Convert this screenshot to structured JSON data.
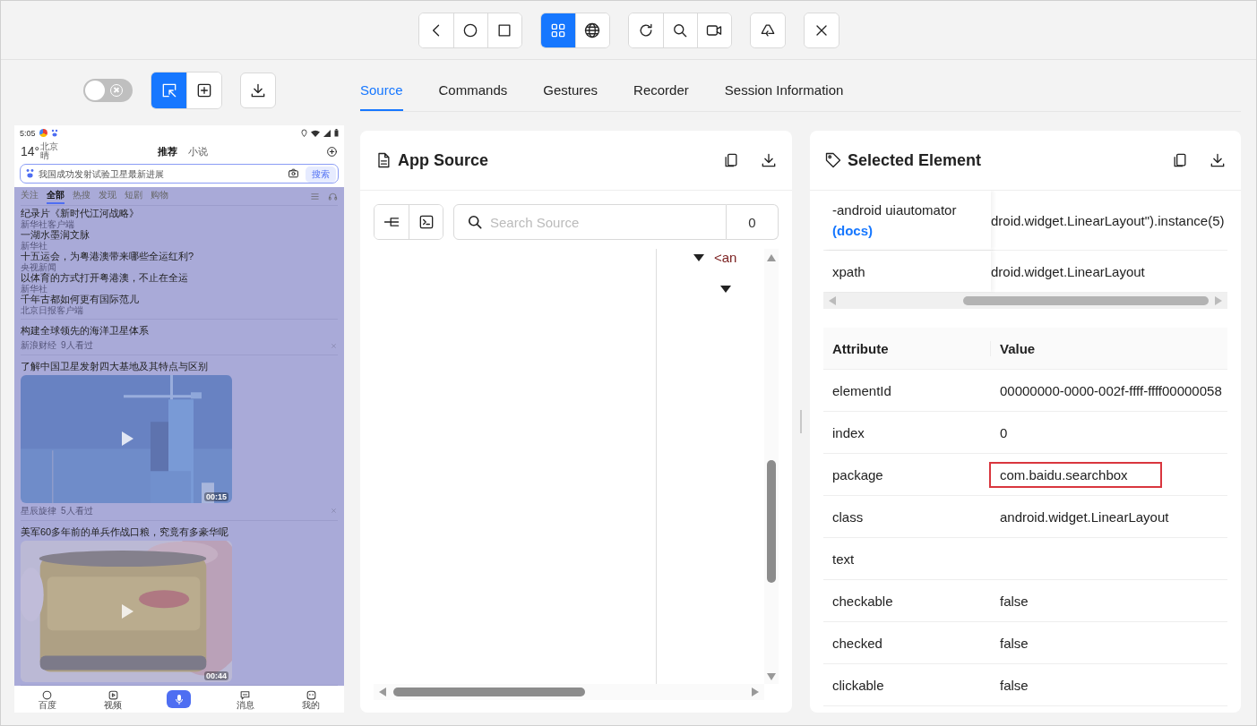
{
  "toolbar": {
    "groups": [
      {
        "buttons": [
          {
            "kind": "back"
          },
          {
            "kind": "home"
          },
          {
            "kind": "recent"
          }
        ]
      },
      {
        "buttons": [
          {
            "kind": "native",
            "selected": true
          },
          {
            "kind": "web",
            "selected": false
          }
        ]
      },
      {
        "buttons": [
          {
            "kind": "refresh"
          },
          {
            "kind": "search"
          },
          {
            "kind": "record"
          }
        ]
      },
      {
        "buttons": [
          {
            "kind": "recycle"
          }
        ]
      },
      {
        "buttons": [
          {
            "kind": "close"
          }
        ]
      }
    ]
  },
  "inspector_tools": {
    "toggle": {
      "on": false
    },
    "modes": [
      {
        "kind": "select",
        "selected": true
      },
      {
        "kind": "tap",
        "selected": false
      }
    ],
    "download": {
      "kind": "download"
    }
  },
  "tabs": [
    {
      "label": "Source",
      "selected": true
    },
    {
      "label": "Commands",
      "selected": false
    },
    {
      "label": "Gestures",
      "selected": false
    },
    {
      "label": "Recorder",
      "selected": false
    },
    {
      "label": "Session Information",
      "selected": false
    }
  ],
  "device": {
    "status_bar": {
      "time": "5:05"
    },
    "weather": {
      "temp": "14°",
      "city": "北京",
      "condition": "晴"
    },
    "top_tabs": [
      {
        "label": "推荐",
        "selected": true
      },
      {
        "label": "小说",
        "selected": false
      }
    ],
    "search": {
      "placeholder": "我国成功发射试验卫星最新进展",
      "button": "搜索"
    },
    "highlighted": true,
    "channels": [
      {
        "label": "关注",
        "selected": false
      },
      {
        "label": "全部",
        "selected": true
      },
      {
        "label": "热搜",
        "selected": false
      },
      {
        "label": "发现",
        "selected": false
      },
      {
        "label": "短剧",
        "selected": false
      },
      {
        "label": "购物",
        "selected": false
      }
    ],
    "hot_list": [
      {
        "title": "纪录片《新时代江河战略》",
        "source": "新华社客户端"
      },
      {
        "title": "一湖水墨润文脉",
        "source": "新华社"
      },
      {
        "title": "十五运会，为粤港澳带来哪些全运红利?",
        "source": "央视新闻"
      },
      {
        "title": "以体育的方式打开粤港澳，不止在全运",
        "source": "新华社"
      },
      {
        "title": "千年古都如何更有国际范儿",
        "source": "北京日报客户端"
      }
    ],
    "feed": [
      {
        "kind": "text",
        "title": "构建全球领先的海洋卫星体系",
        "source": "新浪财经",
        "views": "9人看过"
      },
      {
        "kind": "video",
        "title": "了解中国卫星发射四大基地及其特点与区别",
        "duration": "00:15",
        "source": "星辰旋律",
        "views": "5人看过"
      },
      {
        "kind": "video",
        "title": "美军60多年前的单兵作战口粮，究竟有多豪华呢",
        "duration": "00:44"
      }
    ],
    "nav": [
      {
        "kind": "home",
        "label": "百度"
      },
      {
        "kind": "video",
        "label": "视频"
      },
      {
        "kind": "voice"
      },
      {
        "kind": "message",
        "label": "消息"
      },
      {
        "kind": "profile",
        "label": "我的"
      }
    ]
  },
  "source_panel": {
    "title": "App Source",
    "search": {
      "placeholder": "Search Source",
      "count": "0"
    },
    "tree": [
      {
        "expanded": true,
        "tag": "<an",
        "children": [
          {
            "expanded": true
          }
        ]
      }
    ]
  },
  "element_panel": {
    "title": "Selected Element",
    "selectors": [
      {
        "name": "-android uiautomator",
        "link": "(docs)",
        "value": "droid.widget.LinearLayout\").instance(5)"
      },
      {
        "name": "xpath",
        "value": "droid.widget.LinearLayout"
      }
    ],
    "columns": [
      "Attribute",
      "Value"
    ],
    "attributes": [
      {
        "name": "elementId",
        "value": "00000000-0000-002f-ffff-ffff00000058",
        "highlighted": false
      },
      {
        "name": "index",
        "value": "0",
        "highlighted": false
      },
      {
        "name": "package",
        "value": "com.baidu.searchbox",
        "highlighted": true
      },
      {
        "name": "class",
        "value": "android.widget.LinearLayout",
        "highlighted": false
      },
      {
        "name": "text",
        "highlighted": false
      },
      {
        "name": "checkable",
        "value": "false",
        "highlighted": false
      },
      {
        "name": "checked",
        "value": "false",
        "highlighted": false
      },
      {
        "name": "clickable",
        "value": "false",
        "highlighted": false
      }
    ]
  }
}
